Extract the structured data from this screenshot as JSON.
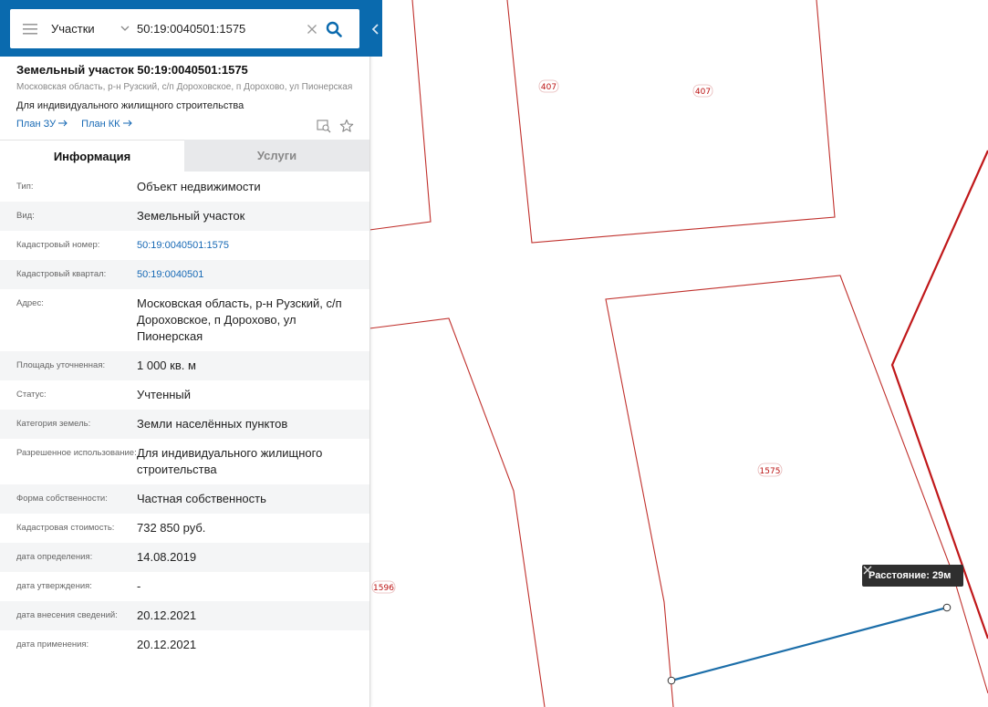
{
  "search": {
    "category": "Участки",
    "query": "50:19:0040501:1575"
  },
  "parcel": {
    "title": "Земельный участок 50:19:0040501:1575",
    "address": "Московская область, р-н Рузский, с/п Дороховское, п Дорохово, ул Пионерская",
    "use": "Для индивидуального жилищного строительства",
    "links": [
      "План ЗУ",
      "План КК"
    ]
  },
  "tabs": [
    "Информация",
    "Услуги"
  ],
  "info_rows": [
    {
      "label": "Тип:",
      "value": "Объект недвижимости"
    },
    {
      "label": "Вид:",
      "value": "Земельный участок"
    },
    {
      "label": "Кадастровый номер:",
      "value": "50:19:0040501:1575",
      "link": true
    },
    {
      "label": "Кадастровый квартал:",
      "value": "50:19:0040501",
      "link": true
    },
    {
      "label": "Адрес:",
      "value": "Московская область, р-н Рузский, с/п Дороховское, п Дорохово, ул Пионерская"
    },
    {
      "label": "Площадь уточненная:",
      "value": "1 000 кв. м"
    },
    {
      "label": "Статус:",
      "value": "Учтенный"
    },
    {
      "label": "Категория земель:",
      "value": "Земли населённых пунктов"
    },
    {
      "label": "Разрешенное использование:",
      "value": "Для индивидуального жилищного строительства"
    },
    {
      "label": "Форма собственности:",
      "value": "Частная собственность"
    },
    {
      "label": "Кадастровая стоимость:",
      "value": "732 850 руб."
    },
    {
      "label": "дата определения:",
      "value": "14.08.2019"
    },
    {
      "label": "дата утверждения:",
      "value": "-"
    },
    {
      "label": "дата внесения сведений:",
      "value": "20.12.2021"
    },
    {
      "label": "дата применения:",
      "value": "20.12.2021"
    }
  ],
  "map": {
    "parcel_labels": [
      "407",
      "407",
      "1575",
      "1596"
    ],
    "distance_label": "Расстояние: 29м"
  },
  "colors": {
    "header_blue": "#0a6aae",
    "link_blue": "#1769b5",
    "parcel_red": "#c0302c",
    "measure_blue": "#1c6ea9"
  },
  "icons": [
    "menu-icon",
    "chevron-down-icon",
    "clear-icon",
    "search-icon",
    "chevron-left-icon",
    "arrow-right-icon",
    "map-search-icon",
    "star-icon",
    "close-icon"
  ]
}
